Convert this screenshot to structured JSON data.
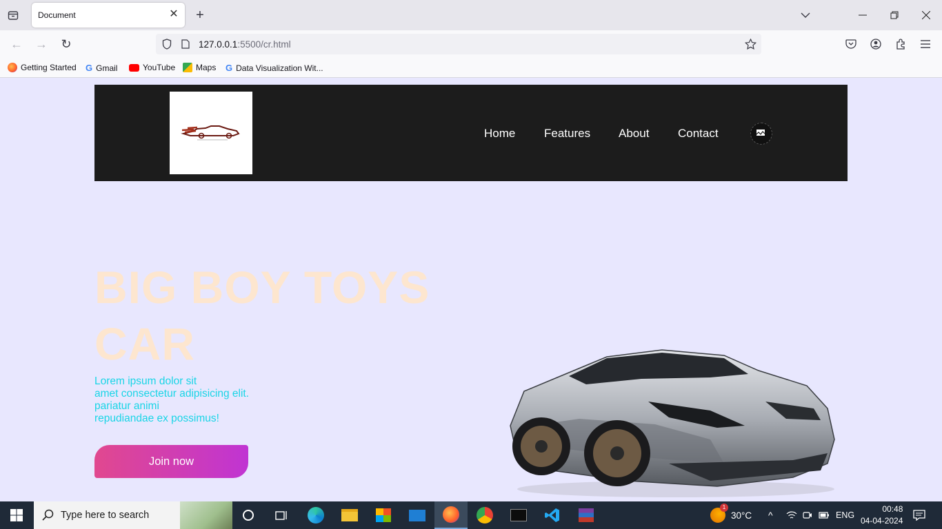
{
  "browser": {
    "tab_title": "Document",
    "url_host": "127.0.0.1",
    "url_path": ":5500/cr.html",
    "bookmarks": [
      "Getting Started",
      "Gmail",
      "YouTube",
      "Maps",
      "Data Visualization Wit..."
    ]
  },
  "site": {
    "nav": [
      "Home",
      "Features",
      "About",
      "Contact"
    ],
    "hero_title_line1": "BIG BOY TOYS",
    "hero_title_line2": "CAR",
    "hero_text": [
      "Lorem ipsum dolor sit",
      "amet consectetur adipisicing elit.",
      "pariatur animi",
      "repudiandae ex possimus!"
    ],
    "cta_label": "Join now",
    "colors": {
      "header_bg": "#1c1c1c",
      "page_bg": "#e8e7fe",
      "title": "#fde6cf",
      "text": "#19d5e6",
      "cta_start": "#e1488f",
      "cta_end": "#c034d3"
    }
  },
  "taskbar": {
    "search_placeholder": "Type here to search",
    "weather_badge": "1",
    "temperature": "30°C",
    "language": "ENG",
    "time": "00:48",
    "date": "04-04-2024"
  }
}
